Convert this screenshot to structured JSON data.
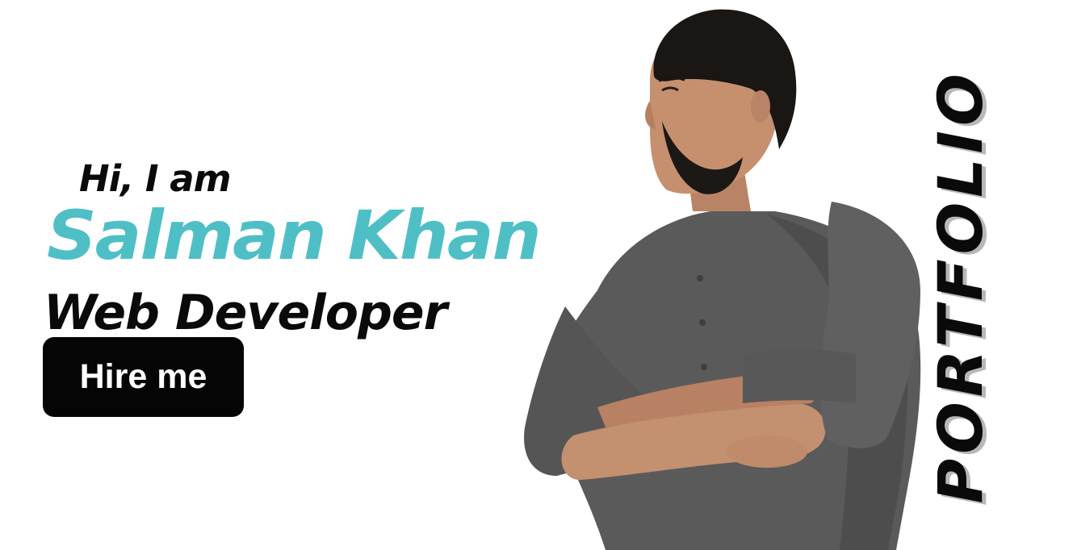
{
  "hero": {
    "greeting": "Hi, I am",
    "name": "Salman Khan",
    "role": "Web Developer",
    "cta_label": "Hire me"
  },
  "side_title": "PORTFOLIO",
  "portrait": {
    "description_icon": "person-portrait"
  },
  "colors": {
    "accent": "#4fbfc6",
    "text": "#0a0a0a",
    "button_bg": "#050505",
    "button_text": "#ffffff",
    "shirt": "#5b5b5b",
    "skin": "#c39070",
    "hair": "#1a1613"
  }
}
